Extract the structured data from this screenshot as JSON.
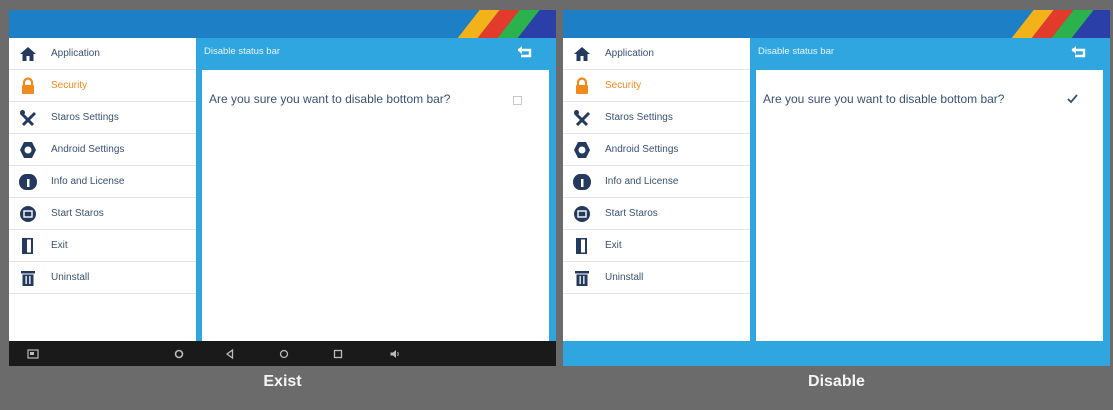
{
  "screens": [
    {
      "caption": "Exist",
      "sidebar": {
        "items": [
          {
            "label": "Application",
            "icon": "home-icon",
            "active": false
          },
          {
            "label": "Security",
            "icon": "lock-icon",
            "active": true
          },
          {
            "label": "Staros Settings",
            "icon": "tools-icon",
            "active": false
          },
          {
            "label": "Android Settings",
            "icon": "gear-icon",
            "active": false
          },
          {
            "label": "Info and License",
            "icon": "info-icon",
            "active": false
          },
          {
            "label": "Start Staros",
            "icon": "launch-icon",
            "active": false
          },
          {
            "label": "Exit",
            "icon": "door-icon",
            "active": false
          },
          {
            "label": "Uninstall",
            "icon": "trash-icon",
            "active": false
          }
        ]
      },
      "header": {
        "title": "Disable status bar"
      },
      "content": {
        "question": "Are you sure you want to disable bottom bar?",
        "checked": false
      },
      "bottom_bar": "android-navigation-bar"
    },
    {
      "caption": "Disable",
      "sidebar": {
        "items": [
          {
            "label": "Application",
            "icon": "home-icon",
            "active": false
          },
          {
            "label": "Security",
            "icon": "lock-icon",
            "active": true
          },
          {
            "label": "Staros Settings",
            "icon": "tools-icon",
            "active": false
          },
          {
            "label": "Android Settings",
            "icon": "gear-icon",
            "active": false
          },
          {
            "label": "Info and License",
            "icon": "info-icon",
            "active": false
          },
          {
            "label": "Start Staros",
            "icon": "launch-icon",
            "active": false
          },
          {
            "label": "Exit",
            "icon": "door-icon",
            "active": false
          },
          {
            "label": "Uninstall",
            "icon": "trash-icon",
            "active": false
          }
        ]
      },
      "header": {
        "title": "Disable status bar"
      },
      "content": {
        "question": "Are you sure you want to disable bottom bar?",
        "checked": true
      },
      "bottom_bar": "hidden"
    }
  ],
  "colors": {
    "accent": "#2fa6df",
    "topbar": "#1d7fc5",
    "icon": "#233a5e",
    "active": "#f08a1d",
    "label": "#3a5170"
  }
}
